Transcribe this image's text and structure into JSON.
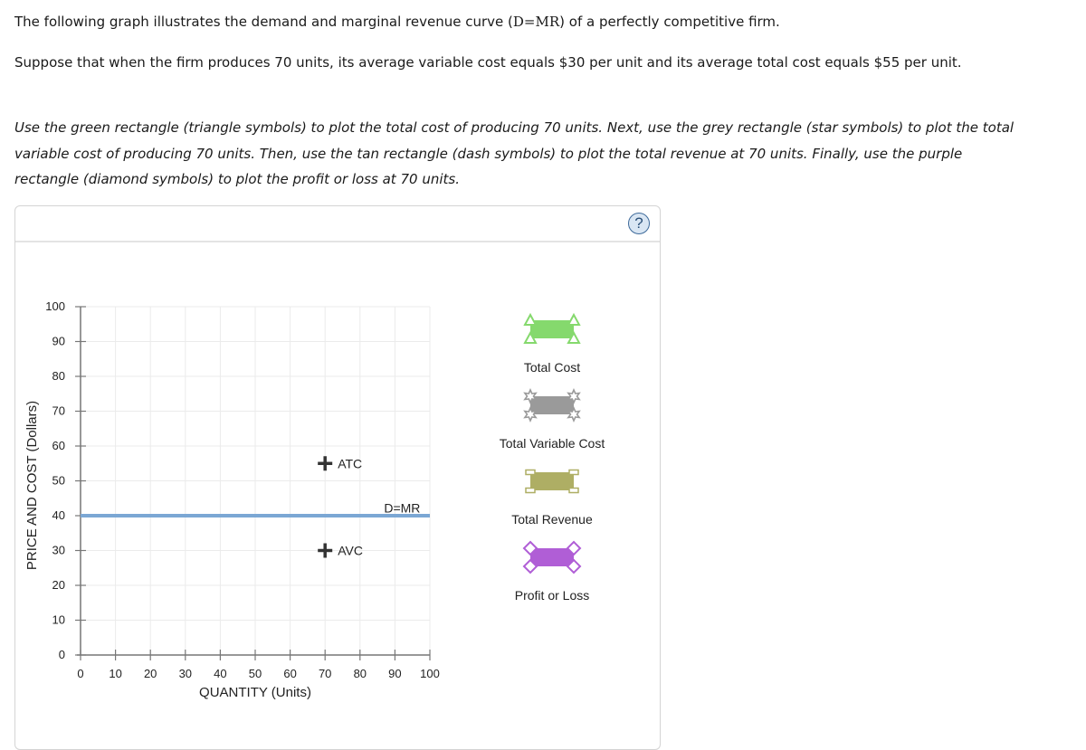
{
  "intro": {
    "line1_pre": "The following graph illustrates the demand and marginal revenue curve (",
    "line1_sym": "D=MR",
    "line1_post": ") of a perfectly competitive firm.",
    "line2": "Suppose that when the firm produces 70 units, its average variable cost equals $30 per unit and its average total cost equals $55 per unit.",
    "instructions": "Use the green rectangle (triangle symbols) to plot the total cost of producing 70 units. Next, use the grey rectangle (star symbols) to plot the total variable cost of producing 70 units. Then, use the tan rectangle (dash symbols) to plot the total revenue at 70 units. Finally, use the purple rectangle (diamond symbols) to plot the profit or loss at 70 units."
  },
  "panel": {
    "help_label": "?"
  },
  "chart_data": {
    "type": "line",
    "xlabel": "QUANTITY (Units)",
    "ylabel": "PRICE AND COST (Dollars)",
    "xlim": [
      0,
      100
    ],
    "ylim": [
      0,
      100
    ],
    "xticks": [
      0,
      10,
      20,
      30,
      40,
      50,
      60,
      70,
      80,
      90,
      100
    ],
    "yticks": [
      0,
      10,
      20,
      30,
      40,
      50,
      60,
      70,
      80,
      90,
      100
    ],
    "grid": true,
    "series": [
      {
        "name": "D=MR",
        "type": "line",
        "color": "#7ba7d4",
        "points": [
          [
            0,
            40
          ],
          [
            100,
            40
          ]
        ],
        "label": "D=MR",
        "label_at": [
          90,
          43
        ]
      }
    ],
    "points": [
      {
        "name": "ATC",
        "x": 70,
        "y": 55,
        "marker": "plus",
        "label": "ATC"
      },
      {
        "name": "AVC",
        "x": 70,
        "y": 30,
        "marker": "plus",
        "label": "AVC"
      }
    ],
    "legend_placement": "right",
    "legend": [
      {
        "label": "Total Cost",
        "color": "#85d96d",
        "symbol": "triangle"
      },
      {
        "label": "Total Variable Cost",
        "color": "#9a9a9a",
        "symbol": "star"
      },
      {
        "label": "Total Revenue",
        "color": "#aeae64",
        "symbol": "dash"
      },
      {
        "label": "Profit or Loss",
        "color": "#b05ed6",
        "symbol": "diamond"
      }
    ]
  }
}
